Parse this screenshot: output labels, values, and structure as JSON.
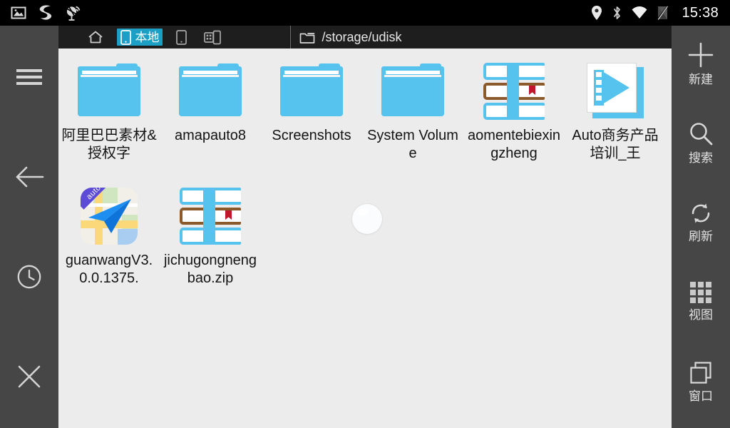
{
  "statusbar": {
    "left_icons": [
      "gallery-icon",
      "sogou-input-icon",
      "gps-satellite-icon"
    ],
    "right_icons": [
      "location-pin-icon",
      "bluetooth-icon",
      "wifi-icon",
      "sim-card-off-icon"
    ],
    "clock": "15:38"
  },
  "tabbar": {
    "home_icon": "home-icon",
    "tabs": [
      {
        "icon": "phone-icon",
        "label": "本地",
        "active": true
      },
      {
        "icon": "phone-icon",
        "label": "",
        "active": false
      },
      {
        "icon": "network-devices-icon",
        "label": "",
        "active": false
      }
    ],
    "path_icon": "folder-icon",
    "path": "/storage/udisk",
    "active_color": "#1b9fc4"
  },
  "left_sidebar": {
    "items": [
      {
        "name": "menu",
        "icon": "hamburger-menu-icon"
      },
      {
        "name": "back",
        "icon": "arrow-left-icon"
      },
      {
        "name": "history",
        "icon": "clock-icon"
      },
      {
        "name": "close",
        "icon": "close-x-icon"
      }
    ]
  },
  "right_sidebar": {
    "items": [
      {
        "name": "new",
        "icon": "plus-icon",
        "label": "新建"
      },
      {
        "name": "search",
        "icon": "search-icon",
        "label": "搜索"
      },
      {
        "name": "refresh",
        "icon": "refresh-icon",
        "label": "刷新"
      },
      {
        "name": "view",
        "icon": "grid-view-icon",
        "label": "视图"
      },
      {
        "name": "window",
        "icon": "windows-overlap-icon",
        "label": "窗口"
      }
    ]
  },
  "files": [
    {
      "name": "阿里巴巴素材&授权字",
      "icon": "folder-icon",
      "type": "folder"
    },
    {
      "name": "amapauto8",
      "icon": "folder-icon",
      "type": "folder"
    },
    {
      "name": "Screenshots",
      "icon": "folder-icon",
      "type": "folder"
    },
    {
      "name": "System Volume",
      "icon": "folder-icon",
      "type": "folder"
    },
    {
      "name": "aomentebiexingzheng",
      "icon": "archive-books-icon",
      "type": "archive"
    },
    {
      "name": "Auto商务产品培训_王",
      "icon": "video-film-icon",
      "type": "video"
    },
    {
      "name": "guanwangV3.0.0.1375.",
      "icon": "amap-app-icon",
      "type": "apk"
    },
    {
      "name": "jichugongnengbao.zip",
      "icon": "archive-books-icon",
      "type": "archive"
    }
  ],
  "loading": {
    "icon": "loading-spinner-icon"
  },
  "colors": {
    "status_bar": "#000000",
    "tab_bar": "#1e1e1e",
    "sidebar": "#464646",
    "content_bg": "#ececec",
    "accent": "#1b9fc4",
    "folder_blue": "#55c3ee"
  }
}
